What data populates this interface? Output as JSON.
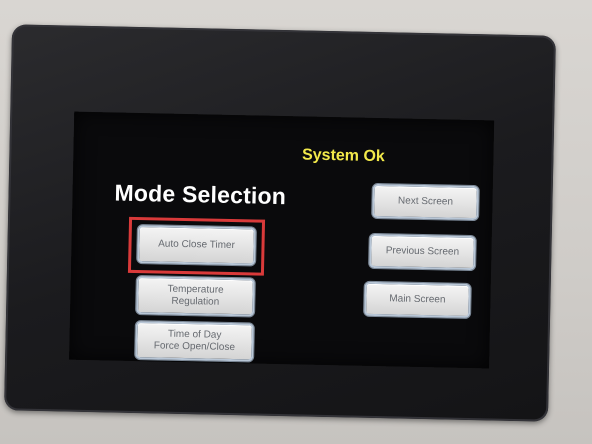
{
  "screen": {
    "status": "System Ok",
    "title": "Mode Selection"
  },
  "left_buttons": [
    {
      "label": "Auto Close Timer"
    },
    {
      "label": "Temperature\nRegulation"
    },
    {
      "label": "Time of Day\nForce Open/Close"
    }
  ],
  "right_buttons": [
    {
      "label": "Next Screen"
    },
    {
      "label": "Previous Screen"
    },
    {
      "label": "Main Screen"
    }
  ],
  "colors": {
    "status_text": "#f2e94a",
    "highlight": "#d93a3a"
  }
}
